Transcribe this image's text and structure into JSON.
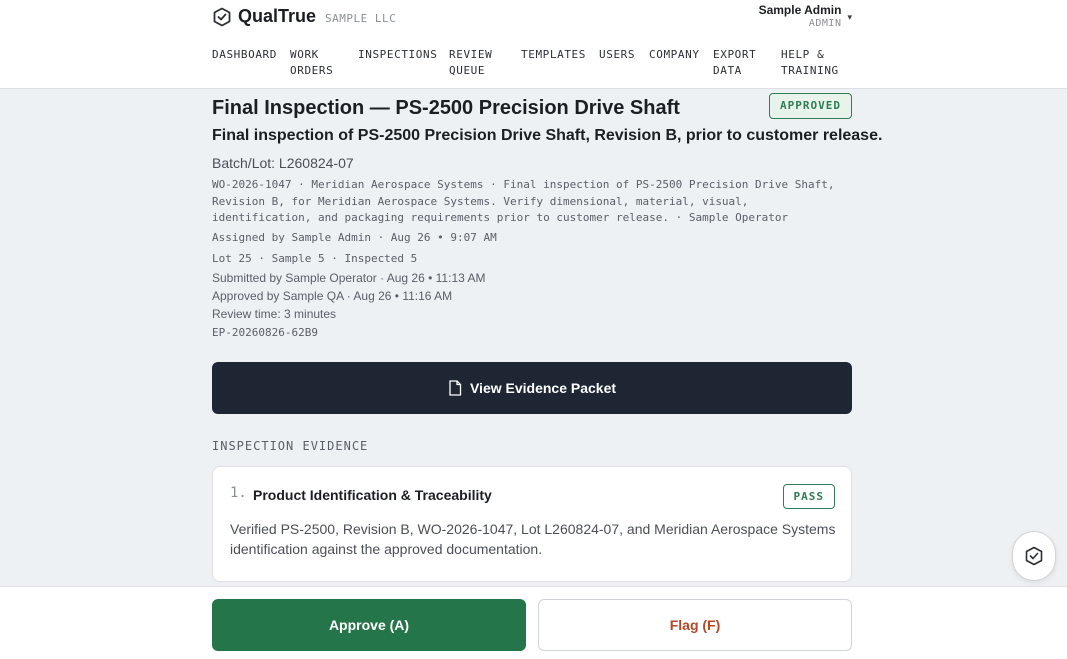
{
  "brand": {
    "name": "QualTrue",
    "company": "SAMPLE LLC",
    "logo_icon": "shield-check-icon"
  },
  "user": {
    "name": "Sample Admin",
    "role": "ADMIN",
    "caret": "▾"
  },
  "nav": {
    "items": [
      {
        "label": "DASHBOARD"
      },
      {
        "label": "WORK\nORDERS"
      },
      {
        "label": "INSPECTIONS"
      },
      {
        "label": "REVIEW\nQUEUE"
      },
      {
        "label": "TEMPLATES"
      },
      {
        "label": "USERS"
      },
      {
        "label": "COMPANY"
      },
      {
        "label": "EXPORT\nDATA"
      },
      {
        "label": "HELP &\nTRAINING"
      }
    ]
  },
  "inspection": {
    "title": "Final Inspection — PS-2500 Precision Drive Shaft",
    "status": "APPROVED",
    "subtitle": "Final inspection of PS-2500 Precision Drive Shaft, Revision B, prior to customer release.",
    "batch": "Batch/Lot: L260824-07",
    "meta_summary": "WO-2026-1047 · Meridian Aerospace Systems · Final inspection of PS-2500 Precision Drive Shaft, Revision B, for Meridian Aerospace Systems. Verify dimensional, material, visual, identification, and packaging requirements prior to customer release. · Sample Operator",
    "assigned": "Assigned by Sample Admin · Aug 26 • 9:07 AM",
    "counts": "Lot 25 · Sample 5 · Inspected 5",
    "submitted": "Submitted by Sample Operator · Aug 26 • 11:13 AM",
    "approved": "Approved by Sample QA · Aug 26 • 11:16 AM",
    "review_time": "Review time: 3 minutes",
    "packet_id": "EP-20260826-62B9",
    "evidence_button": "View Evidence Packet",
    "evidence_icon": "document-icon"
  },
  "evidence": {
    "section_title": "INSPECTION EVIDENCE",
    "items": [
      {
        "number": "1.",
        "title": "Product Identification & Traceability",
        "result": "PASS",
        "description": "Verified PS-2500, Revision B, WO-2026-1047, Lot L260824-07, and Meridian Aerospace Systems identification against the approved documentation."
      }
    ]
  },
  "actions": {
    "approve": "Approve (A)",
    "flag": "Flag (F)"
  },
  "colors": {
    "accent_green": "#25754a",
    "flag_red": "#b34726",
    "dark_button": "#1e2533"
  }
}
